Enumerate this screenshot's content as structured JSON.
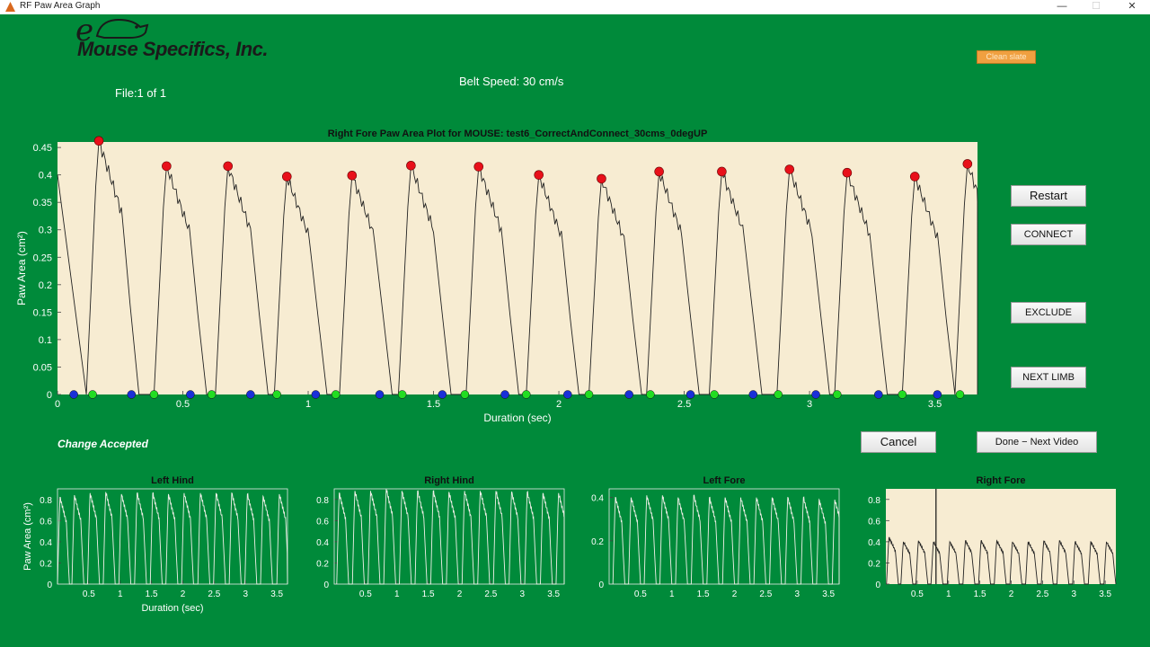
{
  "window": {
    "title": "RF Paw Area Graph",
    "controls": [
      "—",
      "☐",
      "✕"
    ]
  },
  "logo": {
    "text": "Mouse Specifics, Inc.",
    "letter": "e"
  },
  "header": {
    "file_label": "File:1  of  1",
    "belt_speed": "Belt Speed:  30 cm/s",
    "clean_slate_button": "Clean slate"
  },
  "buttons": {
    "restart": "Restart",
    "connect": "CONNECT",
    "exclude": "EXCLUDE",
    "next_limb": "NEXT LIMB",
    "cancel": "Cancel",
    "done_next": "Done − Next Video"
  },
  "status": {
    "message": "Change Accepted"
  },
  "colors": {
    "background": "#008a3a",
    "plot_bg": "#f7ecd2",
    "peak_marker": "#e8101a",
    "trough_start_marker": "#1a2fd8",
    "trough_end_marker": "#22dd22"
  },
  "chart_data": [
    {
      "id": "main",
      "type": "line",
      "title": "Right Fore Paw Area Plot for MOUSE: test6_CorrectAndConnect_30cms_0degUP",
      "xlabel": "Duration (sec)",
      "ylabel": "Paw Area (cm²)",
      "xlim": [
        0,
        3.67
      ],
      "ylim": [
        0,
        0.46
      ],
      "xticks": [
        0,
        0.5,
        1,
        1.5,
        2,
        2.5,
        3,
        3.5
      ],
      "yticks": [
        0,
        0.05,
        0.1,
        0.15,
        0.2,
        0.25,
        0.3,
        0.35,
        0.4,
        0.45
      ],
      "grid": false,
      "peaks": [
        [
          0.165,
          0.462
        ],
        [
          0.435,
          0.416
        ],
        [
          0.68,
          0.416
        ],
        [
          0.915,
          0.397
        ],
        [
          1.175,
          0.399
        ],
        [
          1.41,
          0.417
        ],
        [
          1.68,
          0.415
        ],
        [
          1.92,
          0.4
        ],
        [
          2.17,
          0.393
        ],
        [
          2.4,
          0.406
        ],
        [
          2.65,
          0.406
        ],
        [
          2.92,
          0.41
        ],
        [
          3.15,
          0.404
        ],
        [
          3.42,
          0.397
        ],
        [
          3.63,
          0.42
        ]
      ],
      "stance_starts": [
        0.14,
        0.385,
        0.615,
        0.875,
        1.11,
        1.375,
        1.625,
        1.87,
        2.12,
        2.365,
        2.62,
        2.875,
        3.11,
        3.37,
        3.6
      ],
      "stance_ends": [
        0.065,
        0.295,
        0.53,
        0.77,
        1.03,
        1.285,
        1.535,
        1.785,
        2.035,
        2.28,
        2.525,
        2.775,
        3.025,
        3.275,
        3.51
      ],
      "start_value": 0.4
    },
    {
      "id": "left-hind",
      "type": "line",
      "title": "Left Hind",
      "xlabel": "Duration (sec)",
      "ylabel": "Paw Area (cm²)",
      "xlim": [
        0,
        3.67
      ],
      "ylim": [
        0,
        0.9
      ],
      "xticks": [
        0.5,
        1,
        1.5,
        2,
        2.5,
        3,
        3.5
      ],
      "yticks": [
        0,
        0.2,
        0.4,
        0.6,
        0.8
      ],
      "grid": false,
      "peaks": [
        [
          0.04,
          0.82
        ],
        [
          0.27,
          0.84
        ],
        [
          0.52,
          0.86
        ],
        [
          0.77,
          0.87
        ],
        [
          1.02,
          0.85
        ],
        [
          1.27,
          0.86
        ],
        [
          1.52,
          0.86
        ],
        [
          1.77,
          0.85
        ],
        [
          2.02,
          0.86
        ],
        [
          2.28,
          0.86
        ],
        [
          2.53,
          0.86
        ],
        [
          2.78,
          0.86
        ],
        [
          3.03,
          0.85
        ],
        [
          3.28,
          0.83
        ],
        [
          3.54,
          0.85
        ]
      ]
    },
    {
      "id": "right-hind",
      "type": "line",
      "title": "Right Hind",
      "xlabel": "",
      "ylabel": "",
      "xlim": [
        0,
        3.67
      ],
      "ylim": [
        0,
        0.9
      ],
      "xticks": [
        0.5,
        1,
        1.5,
        2,
        2.5,
        3,
        3.5
      ],
      "yticks": [
        0,
        0.2,
        0.4,
        0.6,
        0.8
      ],
      "grid": false,
      "peaks": [
        [
          0.08,
          0.86
        ],
        [
          0.33,
          0.88
        ],
        [
          0.58,
          0.88
        ],
        [
          0.83,
          0.9
        ],
        [
          1.08,
          0.88
        ],
        [
          1.33,
          0.88
        ],
        [
          1.58,
          0.88
        ],
        [
          1.83,
          0.87
        ],
        [
          2.08,
          0.88
        ],
        [
          2.33,
          0.88
        ],
        [
          2.58,
          0.88
        ],
        [
          2.83,
          0.87
        ],
        [
          3.08,
          0.87
        ],
        [
          3.33,
          0.86
        ],
        [
          3.58,
          0.86
        ]
      ]
    },
    {
      "id": "left-fore",
      "type": "line",
      "title": "Left Fore",
      "xlabel": "",
      "ylabel": "",
      "xlim": [
        0,
        3.67
      ],
      "ylim": [
        0,
        0.44
      ],
      "xticks": [
        0.5,
        1,
        1.5,
        2,
        2.5,
        3,
        3.5
      ],
      "yticks": [
        0,
        0.2,
        0.4
      ],
      "grid": false,
      "peaks": [
        [
          0.1,
          0.4
        ],
        [
          0.35,
          0.4
        ],
        [
          0.6,
          0.41
        ],
        [
          0.85,
          0.41
        ],
        [
          1.1,
          0.4
        ],
        [
          1.35,
          0.41
        ],
        [
          1.6,
          0.4
        ],
        [
          1.85,
          0.4
        ],
        [
          2.1,
          0.4
        ],
        [
          2.35,
          0.4
        ],
        [
          2.6,
          0.4
        ],
        [
          2.85,
          0.4
        ],
        [
          3.1,
          0.4
        ],
        [
          3.35,
          0.39
        ],
        [
          3.6,
          0.39
        ]
      ]
    },
    {
      "id": "right-fore",
      "type": "line",
      "title": "Right Fore",
      "xlabel": "",
      "ylabel": "",
      "xlim": [
        0,
        3.67
      ],
      "ylim": [
        0,
        0.9
      ],
      "xticks": [
        0.5,
        1,
        1.5,
        2,
        2.5,
        3,
        3.5
      ],
      "yticks": [
        0,
        0.2,
        0.4,
        0.6,
        0.8
      ],
      "grid": false,
      "cursor_x": 0.8,
      "peaks": [
        [
          0.05,
          0.44
        ],
        [
          0.28,
          0.4
        ],
        [
          0.52,
          0.41
        ],
        [
          0.76,
          0.4
        ],
        [
          1.02,
          0.4
        ],
        [
          1.27,
          0.41
        ],
        [
          1.52,
          0.41
        ],
        [
          1.77,
          0.41
        ],
        [
          2.02,
          0.4
        ],
        [
          2.27,
          0.4
        ],
        [
          2.52,
          0.41
        ],
        [
          2.77,
          0.41
        ],
        [
          3.02,
          0.4
        ],
        [
          3.27,
          0.4
        ],
        [
          3.52,
          0.4
        ]
      ]
    }
  ]
}
